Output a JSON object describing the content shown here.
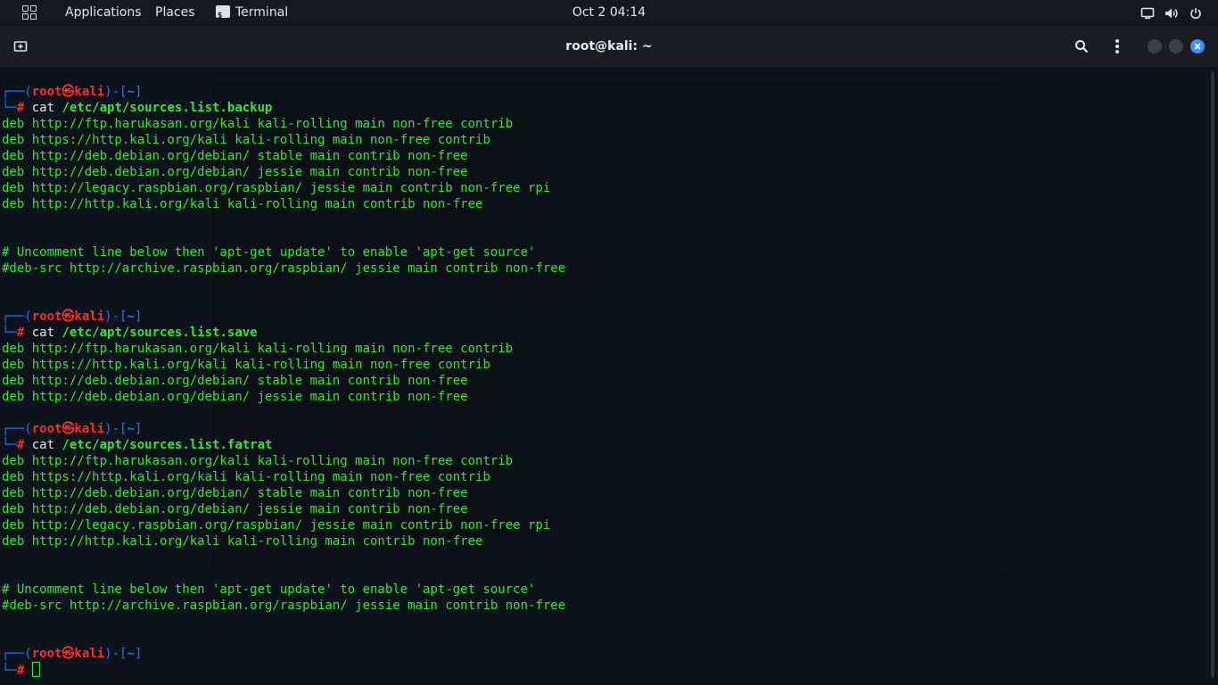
{
  "topbar": {
    "applications": "Applications",
    "places": "Places",
    "terminal_app": "Terminal",
    "clock": "Oct 2  04:14",
    "icons": [
      "activities-grid-icon",
      "terminal-app-icon",
      "display-icon",
      "volume-icon",
      "power-icon"
    ]
  },
  "window": {
    "title": "root@kali: ~",
    "icons": [
      "new-tab-icon",
      "search-icon",
      "menu-kebab-icon",
      "minimize-icon",
      "maximize-icon",
      "close-icon"
    ],
    "colors": {
      "close": "#3d8fff",
      "minmax": "#3a3f46"
    }
  },
  "prompt": {
    "top": "┌──",
    "bottom": "└─",
    "user": "root",
    "at": "㉿",
    "host": "kali",
    "sep": ")-[",
    "dir": "~",
    "end": "]",
    "hash": "#"
  },
  "blocks": [
    {
      "command": "cat",
      "arg": "/etc/apt/sources.list.backup",
      "output": [
        "deb http://ftp.harukasan.org/kali kali-rolling main non-free contrib",
        "deb https://http.kali.org/kali kali-rolling main non-free contrib",
        "deb http://deb.debian.org/debian/ stable main contrib non-free",
        "deb http://deb.debian.org/debian/ jessie main contrib non-free",
        "deb http://legacy.raspbian.org/raspbian/ jessie main contrib non-free rpi",
        "deb http://http.kali.org/kali kali-rolling main contrib non-free",
        "",
        "",
        "# Uncomment line below then 'apt-get update' to enable 'apt-get source'",
        "#deb-src http://archive.raspbian.org/raspbian/ jessie main contrib non-free",
        "",
        ""
      ]
    },
    {
      "command": "cat",
      "arg": "/etc/apt/sources.list.save",
      "output": [
        "deb http://ftp.harukasan.org/kali kali-rolling main non-free contrib",
        "deb https://http.kali.org/kali kali-rolling main non-free contrib",
        "deb http://deb.debian.org/debian/ stable main contrib non-free",
        "deb http://deb.debian.org/debian/ jessie main contrib non-free",
        ""
      ]
    },
    {
      "command": "cat",
      "arg": "/etc/apt/sources.list.fatrat",
      "output": [
        "deb http://ftp.harukasan.org/kali kali-rolling main non-free contrib",
        "deb https://http.kali.org/kali kali-rolling main non-free contrib",
        "deb http://deb.debian.org/debian/ stable main contrib non-free",
        "deb http://deb.debian.org/debian/ jessie main contrib non-free",
        "deb http://legacy.raspbian.org/raspbian/ jessie main contrib non-free rpi",
        "deb http://http.kali.org/kali kali-rolling main contrib non-free",
        "",
        "",
        "# Uncomment line below then 'apt-get update' to enable 'apt-get source'",
        "#deb-src http://archive.raspbian.org/raspbian/ jessie main contrib non-free",
        "",
        ""
      ]
    }
  ],
  "colors": {
    "output_green": "#33e633",
    "prompt_red": "#ff2a2a",
    "prompt_blue": "#2a6fff",
    "background": "#0d131a"
  }
}
